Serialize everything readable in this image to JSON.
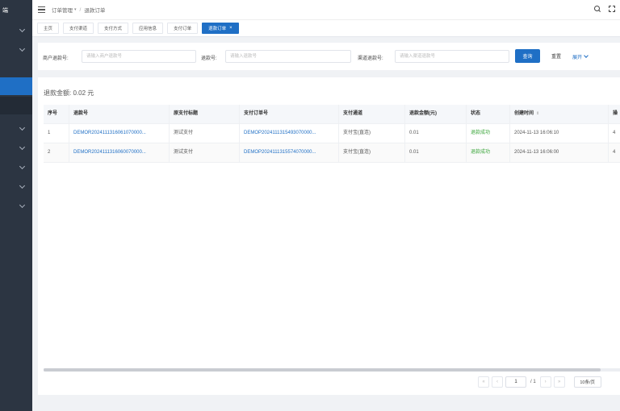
{
  "sidebar": {
    "logo_text": "端",
    "items": [
      {
        "label": "",
        "expandable": true
      },
      {
        "label": "",
        "expandable": true
      },
      {
        "label": "",
        "active": true
      },
      {
        "label": "",
        "sub": true
      },
      {
        "label": "",
        "expandable": true
      },
      {
        "label": "",
        "expandable": true
      },
      {
        "label": "",
        "expandable": true
      },
      {
        "label": "",
        "expandable": true
      },
      {
        "label": "",
        "expandable": true
      }
    ]
  },
  "header": {
    "breadcrumb": [
      "订单管理",
      "退款订单"
    ],
    "icons": [
      "search-icon",
      "fullscreen-icon"
    ]
  },
  "tags": [
    {
      "label": "主页",
      "active": false
    },
    {
      "label": "支付渠道",
      "active": false
    },
    {
      "label": "支付方式",
      "active": false
    },
    {
      "label": "应用信息",
      "active": false
    },
    {
      "label": "支付订单",
      "active": false
    },
    {
      "label": "退款订单",
      "active": true,
      "closable": "×"
    }
  ],
  "search": {
    "fields": [
      {
        "label": "商户退款号:",
        "placeholder": "请输入商户退款号"
      },
      {
        "label": "退款号:",
        "placeholder": "请输入退款号"
      },
      {
        "label": "渠道退款号:",
        "placeholder": "请输入渠道退款号"
      }
    ],
    "query_label": "查询",
    "reset_label": "重置",
    "expand_label": "展开"
  },
  "summary": "退款金额: 0.02 元",
  "table": {
    "columns": [
      "序号",
      "退款号",
      "原支付标题",
      "支付订单号",
      "支付通道",
      "退款金额(元)",
      "状态",
      "创建时间",
      "操"
    ],
    "rows": [
      [
        "1",
        "DEMOR2024111316061070000...",
        "测试支付",
        "DEMOP2024111315493070000...",
        "支付宝(直连)",
        "0.01",
        "退款成功",
        "2024-11-13 16:06:10",
        "4"
      ],
      [
        "2",
        "DEMOR2024111316060070000...",
        "测试支付",
        "DEMOP2024111315574070000...",
        "支付宝(直连)",
        "0.01",
        "退款成功",
        "2024-11-13 16:06:00",
        "4"
      ]
    ],
    "sortable_column": "创建时间"
  },
  "pagination": {
    "first": "«",
    "prev": "‹",
    "current_page": "1",
    "total": "/ 1",
    "next": "›",
    "last": "»",
    "page_size": "10条/页"
  },
  "colors": {
    "sidebar_bg": "#2c3542",
    "accent": "#1f6fc5",
    "success": "#3aa53a"
  }
}
